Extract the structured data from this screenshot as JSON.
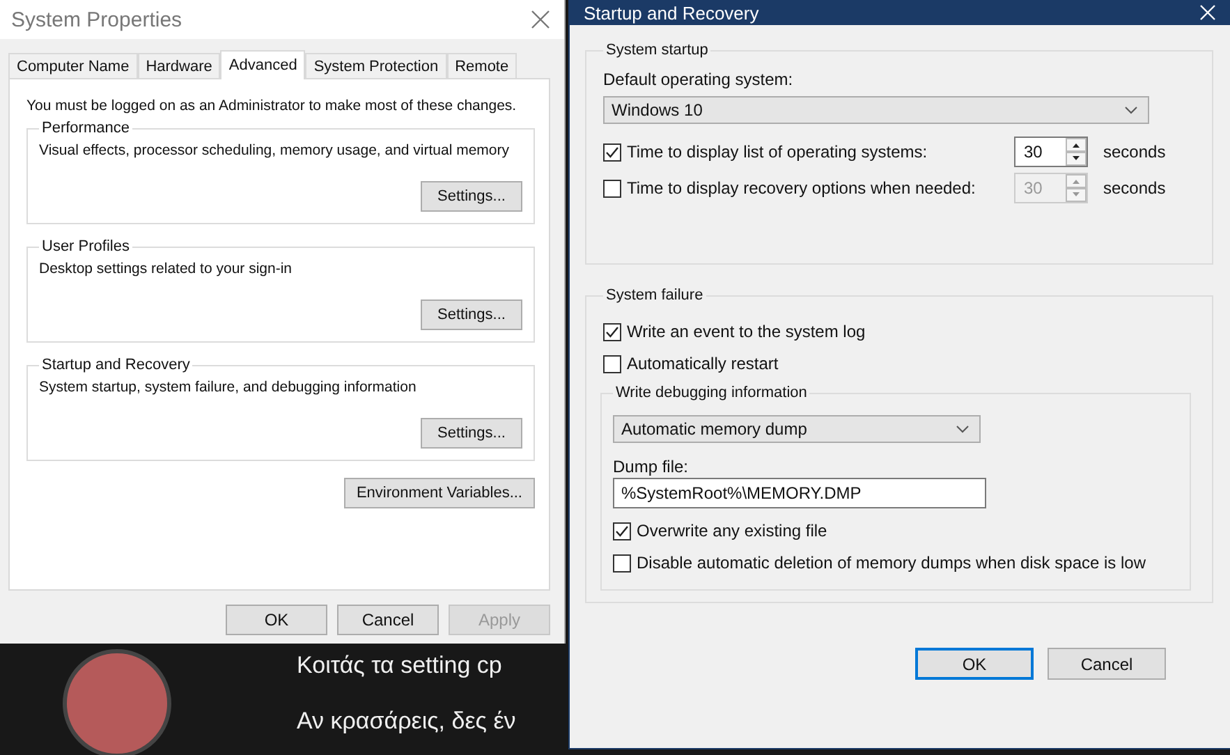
{
  "system_properties": {
    "title": "System Properties",
    "tabs": [
      {
        "label": "Computer Name",
        "selected": false
      },
      {
        "label": "Hardware",
        "selected": false
      },
      {
        "label": "Advanced",
        "selected": true
      },
      {
        "label": "System Protection",
        "selected": false
      },
      {
        "label": "Remote",
        "selected": false
      }
    ],
    "notice": "You must be logged on as an Administrator to make most of these changes.",
    "groups": [
      {
        "title": "Performance",
        "description": "Visual effects, processor scheduling, memory usage, and virtual memory",
        "button": "Settings..."
      },
      {
        "title": "User Profiles",
        "description": "Desktop settings related to your sign-in",
        "button": "Settings..."
      },
      {
        "title": "Startup and Recovery",
        "description": "System startup, system failure, and debugging information",
        "button": "Settings..."
      }
    ],
    "env_button": "Environment Variables...",
    "buttons": [
      {
        "label": "OK",
        "disabled": false
      },
      {
        "label": "Cancel",
        "disabled": false
      },
      {
        "label": "Apply",
        "disabled": true
      }
    ]
  },
  "video_overlay": {
    "captions": [
      "Κοιτάς τα setting cp",
      "Αν κρασάρεις, δες έν"
    ]
  },
  "startup_recovery": {
    "title": "Startup and Recovery",
    "system_startup": {
      "title": "System startup",
      "default_os_label": "Default operating system:",
      "default_os": "Windows 10",
      "options": [
        {
          "label": "Time to display list of operating systems:",
          "checked": true,
          "value": "30",
          "unit": "seconds"
        },
        {
          "label": "Time to display recovery options when needed:",
          "checked": false,
          "value": "30",
          "unit": "seconds"
        }
      ]
    },
    "system_failure": {
      "title": "System failure",
      "options": [
        {
          "label": "Write an event to the system log",
          "checked": true
        },
        {
          "label": "Automatically restart",
          "checked": false
        }
      ],
      "debug": {
        "title": "Write debugging information",
        "dump_type": "Automatic memory dump",
        "dump_file_label": "Dump file:",
        "dump_file": "%SystemRoot%\\MEMORY.DMP",
        "options": [
          {
            "label": "Overwrite any existing file",
            "checked": true
          },
          {
            "label": "Disable automatic deletion of memory dumps when disk space is low",
            "checked": false
          }
        ]
      }
    },
    "buttons": [
      {
        "label": "OK",
        "default": true
      },
      {
        "label": "Cancel",
        "default": false
      }
    ]
  }
}
